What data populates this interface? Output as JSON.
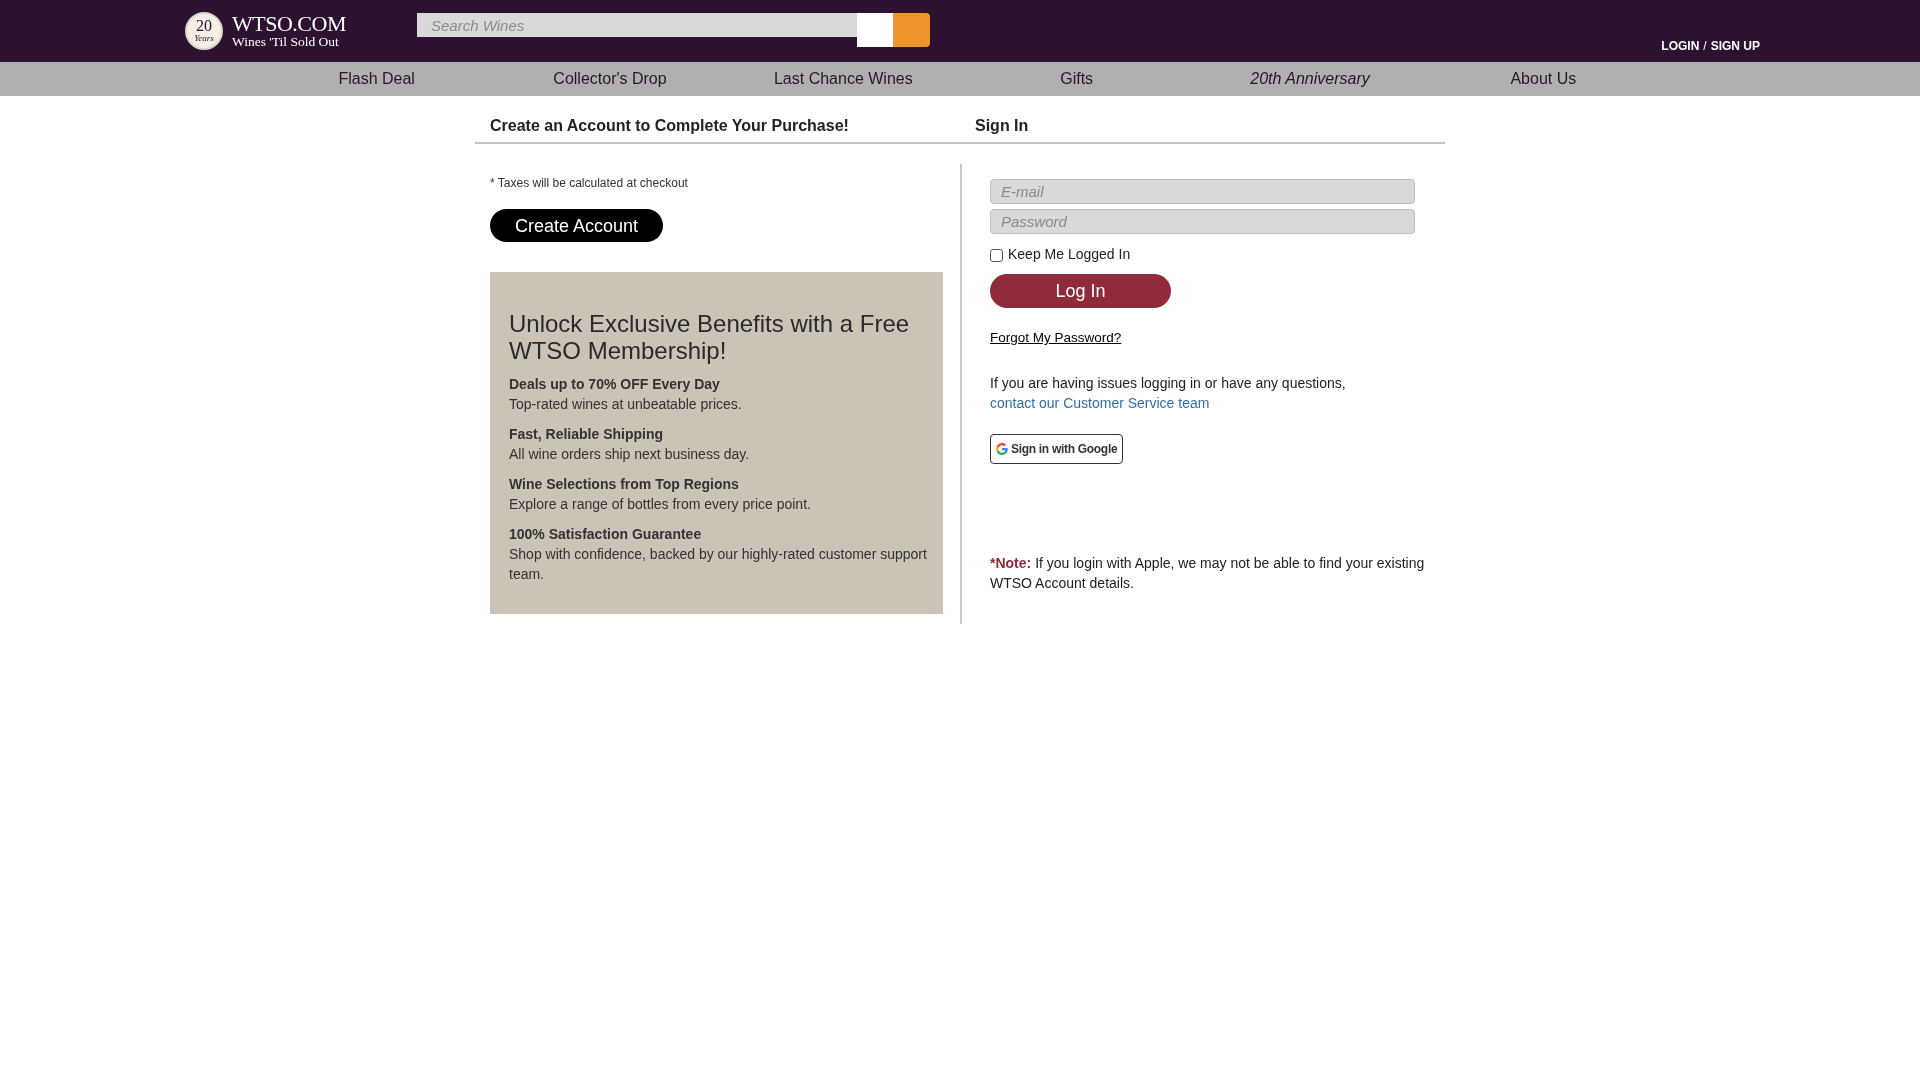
{
  "header": {
    "logo": {
      "seal_number": "20",
      "seal_word": "Years",
      "name": "WTSO.COM",
      "tagline": "Wines 'Til Sold Out"
    },
    "search": {
      "placeholder": "Search Wines"
    },
    "account_links": [
      {
        "label": "LOGIN"
      },
      {
        "label": "SIGN UP"
      }
    ],
    "account_separator": "/"
  },
  "nav": [
    {
      "label": "Flash Deal",
      "kind": "regular"
    },
    {
      "label": "Collector's Drop",
      "kind": "regular"
    },
    {
      "label": "Last Chance Wines",
      "kind": "regular"
    },
    {
      "label": "Gifts",
      "kind": "regular"
    },
    {
      "label": "20th Anniversary",
      "kind": "featured"
    },
    {
      "label": "About Us",
      "kind": "regular"
    }
  ],
  "create_account": {
    "heading": "Create an Account to Complete Your Purchase!",
    "tax_note": "* Taxes will be calculated at checkout",
    "button": "Create Account",
    "benefits": {
      "title": "Unlock Exclusive Benefits with a Free WTSO Membership!",
      "items": [
        {
          "title": "Deals up to 70% OFF Every Day",
          "text": "Top-rated wines at unbeatable prices."
        },
        {
          "title": "Fast, Reliable Shipping",
          "text": "All wine orders ship next business day."
        },
        {
          "title": "Wine Selections from Top Regions",
          "text": "Explore a range of bottles from every price point."
        },
        {
          "title": "100% Satisfaction Guarantee",
          "text": "Shop with confidence, backed by our highly-rated customer support team."
        }
      ]
    }
  },
  "sign_in": {
    "heading": "Sign In",
    "email": {
      "placeholder": "E-mail"
    },
    "password": {
      "placeholder": "Password"
    },
    "keep_logged_in": {
      "label": "Keep Me Logged In",
      "checked": false
    },
    "login_button": "Log In",
    "forgot_link": "Forgot My Password?",
    "help": {
      "text": "If you are having issues logging in or have any questions,",
      "link": "contact our Customer Service team"
    },
    "google_button": "Sign in with Google",
    "note": {
      "label": "*Note:",
      "text": "If you login with Apple, we may not be able to find your existing WTSO Account details."
    }
  }
}
